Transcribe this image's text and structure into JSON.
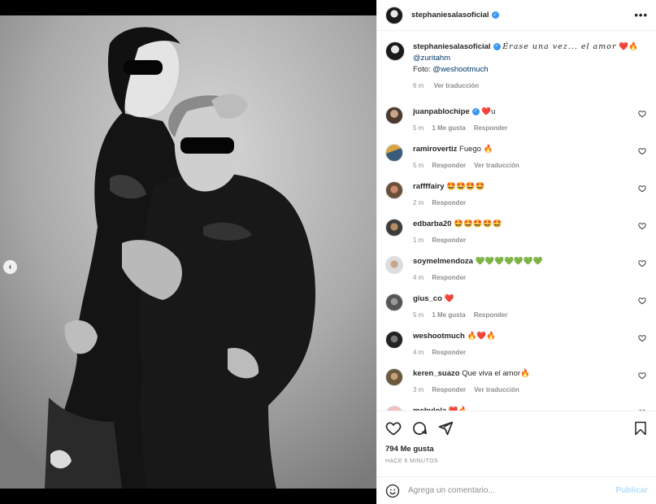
{
  "post": {
    "author": "stephaniesalasoficial",
    "caption_script": "Érase una vez... el amor",
    "caption_emoji": "❤️🔥",
    "mention1": "@zuritahm",
    "photo_prefix": "Foto: ",
    "mention2": "@weshootmuch",
    "time": "6 m",
    "translate": "Ver traducción",
    "likes": "794 Me gusta",
    "ago": "HACE 6 MINUTOS",
    "add_comment_placeholder": "Agrega un comentario...",
    "publish": "Publicar",
    "more": "•••"
  },
  "comments": [
    {
      "user": "juanpablochipe",
      "text": "❤️u",
      "verified": true,
      "time": "5 m",
      "likes": "1 Me gusta",
      "action": "Responder",
      "extra": ""
    },
    {
      "user": "ramirovertiz",
      "text": "Fuego 🔥",
      "verified": false,
      "time": "5 m",
      "likes": "",
      "action": "Responder",
      "extra": "Ver traducción"
    },
    {
      "user": "raffffairy",
      "text": "🤩🤩🤩🤩",
      "verified": false,
      "time": "2 m",
      "likes": "",
      "action": "Responder",
      "extra": ""
    },
    {
      "user": "edbarba20",
      "text": "🤩🤩🤩🤩🤩",
      "verified": false,
      "time": "1 m",
      "likes": "",
      "action": "Responder",
      "extra": ""
    },
    {
      "user": "soymelmendoza",
      "text": "💚💚💚💚💚💚💚",
      "verified": false,
      "time": "4 m",
      "likes": "",
      "action": "Responder",
      "extra": ""
    },
    {
      "user": "gius_co",
      "text": "❤️",
      "verified": false,
      "time": "5 m",
      "likes": "1 Me gusta",
      "action": "Responder",
      "extra": ""
    },
    {
      "user": "weshootmuch",
      "text": "🔥❤️🔥",
      "verified": false,
      "time": "4 m",
      "likes": "",
      "action": "Responder",
      "extra": ""
    },
    {
      "user": "keren_suazo",
      "text": "Que viva el amor🔥",
      "verified": false,
      "time": "3 m",
      "likes": "",
      "action": "Responder",
      "extra": "Ver traducción"
    },
    {
      "user": "mcbylola",
      "text": "❤️🔥",
      "verified": false,
      "time": "",
      "likes": "",
      "action": "",
      "extra": ""
    }
  ],
  "icons": {
    "like": "heart-icon",
    "comment": "comment-icon",
    "share": "send-icon",
    "save": "bookmark-icon",
    "emoji": "emoji-icon",
    "prev": "chevron-left-icon"
  },
  "carousel": {
    "count": 2,
    "active": 2
  },
  "colors": {
    "link": "#00376b",
    "verified": "#3897f0",
    "muted": "#8e8e8e",
    "publish": "#b2dffc"
  }
}
